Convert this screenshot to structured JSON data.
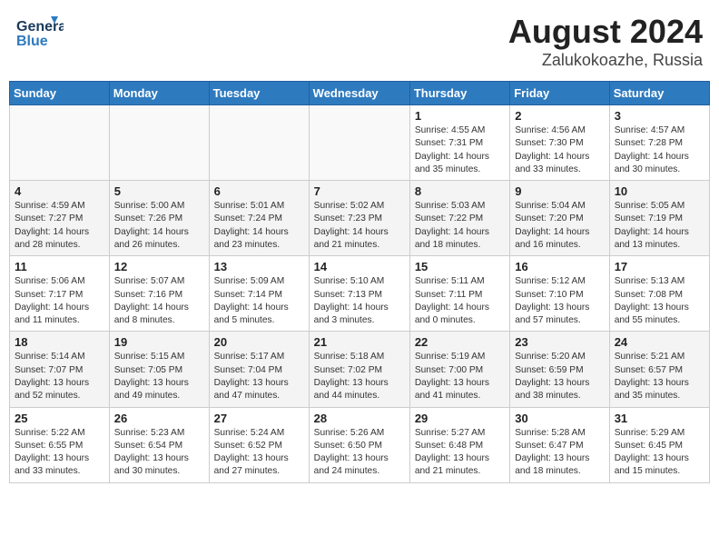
{
  "header": {
    "logo_line1": "General",
    "logo_line2": "Blue",
    "title": "August 2024",
    "subtitle": "Zalukokoazhe, Russia"
  },
  "days_of_week": [
    "Sunday",
    "Monday",
    "Tuesday",
    "Wednesday",
    "Thursday",
    "Friday",
    "Saturday"
  ],
  "weeks": [
    [
      {
        "day": "",
        "info": ""
      },
      {
        "day": "",
        "info": ""
      },
      {
        "day": "",
        "info": ""
      },
      {
        "day": "",
        "info": ""
      },
      {
        "day": "1",
        "info": "Sunrise: 4:55 AM\nSunset: 7:31 PM\nDaylight: 14 hours\nand 35 minutes."
      },
      {
        "day": "2",
        "info": "Sunrise: 4:56 AM\nSunset: 7:30 PM\nDaylight: 14 hours\nand 33 minutes."
      },
      {
        "day": "3",
        "info": "Sunrise: 4:57 AM\nSunset: 7:28 PM\nDaylight: 14 hours\nand 30 minutes."
      }
    ],
    [
      {
        "day": "4",
        "info": "Sunrise: 4:59 AM\nSunset: 7:27 PM\nDaylight: 14 hours\nand 28 minutes."
      },
      {
        "day": "5",
        "info": "Sunrise: 5:00 AM\nSunset: 7:26 PM\nDaylight: 14 hours\nand 26 minutes."
      },
      {
        "day": "6",
        "info": "Sunrise: 5:01 AM\nSunset: 7:24 PM\nDaylight: 14 hours\nand 23 minutes."
      },
      {
        "day": "7",
        "info": "Sunrise: 5:02 AM\nSunset: 7:23 PM\nDaylight: 14 hours\nand 21 minutes."
      },
      {
        "day": "8",
        "info": "Sunrise: 5:03 AM\nSunset: 7:22 PM\nDaylight: 14 hours\nand 18 minutes."
      },
      {
        "day": "9",
        "info": "Sunrise: 5:04 AM\nSunset: 7:20 PM\nDaylight: 14 hours\nand 16 minutes."
      },
      {
        "day": "10",
        "info": "Sunrise: 5:05 AM\nSunset: 7:19 PM\nDaylight: 14 hours\nand 13 minutes."
      }
    ],
    [
      {
        "day": "11",
        "info": "Sunrise: 5:06 AM\nSunset: 7:17 PM\nDaylight: 14 hours\nand 11 minutes."
      },
      {
        "day": "12",
        "info": "Sunrise: 5:07 AM\nSunset: 7:16 PM\nDaylight: 14 hours\nand 8 minutes."
      },
      {
        "day": "13",
        "info": "Sunrise: 5:09 AM\nSunset: 7:14 PM\nDaylight: 14 hours\nand 5 minutes."
      },
      {
        "day": "14",
        "info": "Sunrise: 5:10 AM\nSunset: 7:13 PM\nDaylight: 14 hours\nand 3 minutes."
      },
      {
        "day": "15",
        "info": "Sunrise: 5:11 AM\nSunset: 7:11 PM\nDaylight: 14 hours\nand 0 minutes."
      },
      {
        "day": "16",
        "info": "Sunrise: 5:12 AM\nSunset: 7:10 PM\nDaylight: 13 hours\nand 57 minutes."
      },
      {
        "day": "17",
        "info": "Sunrise: 5:13 AM\nSunset: 7:08 PM\nDaylight: 13 hours\nand 55 minutes."
      }
    ],
    [
      {
        "day": "18",
        "info": "Sunrise: 5:14 AM\nSunset: 7:07 PM\nDaylight: 13 hours\nand 52 minutes."
      },
      {
        "day": "19",
        "info": "Sunrise: 5:15 AM\nSunset: 7:05 PM\nDaylight: 13 hours\nand 49 minutes."
      },
      {
        "day": "20",
        "info": "Sunrise: 5:17 AM\nSunset: 7:04 PM\nDaylight: 13 hours\nand 47 minutes."
      },
      {
        "day": "21",
        "info": "Sunrise: 5:18 AM\nSunset: 7:02 PM\nDaylight: 13 hours\nand 44 minutes."
      },
      {
        "day": "22",
        "info": "Sunrise: 5:19 AM\nSunset: 7:00 PM\nDaylight: 13 hours\nand 41 minutes."
      },
      {
        "day": "23",
        "info": "Sunrise: 5:20 AM\nSunset: 6:59 PM\nDaylight: 13 hours\nand 38 minutes."
      },
      {
        "day": "24",
        "info": "Sunrise: 5:21 AM\nSunset: 6:57 PM\nDaylight: 13 hours\nand 35 minutes."
      }
    ],
    [
      {
        "day": "25",
        "info": "Sunrise: 5:22 AM\nSunset: 6:55 PM\nDaylight: 13 hours\nand 33 minutes."
      },
      {
        "day": "26",
        "info": "Sunrise: 5:23 AM\nSunset: 6:54 PM\nDaylight: 13 hours\nand 30 minutes."
      },
      {
        "day": "27",
        "info": "Sunrise: 5:24 AM\nSunset: 6:52 PM\nDaylight: 13 hours\nand 27 minutes."
      },
      {
        "day": "28",
        "info": "Sunrise: 5:26 AM\nSunset: 6:50 PM\nDaylight: 13 hours\nand 24 minutes."
      },
      {
        "day": "29",
        "info": "Sunrise: 5:27 AM\nSunset: 6:48 PM\nDaylight: 13 hours\nand 21 minutes."
      },
      {
        "day": "30",
        "info": "Sunrise: 5:28 AM\nSunset: 6:47 PM\nDaylight: 13 hours\nand 18 minutes."
      },
      {
        "day": "31",
        "info": "Sunrise: 5:29 AM\nSunset: 6:45 PM\nDaylight: 13 hours\nand 15 minutes."
      }
    ]
  ]
}
